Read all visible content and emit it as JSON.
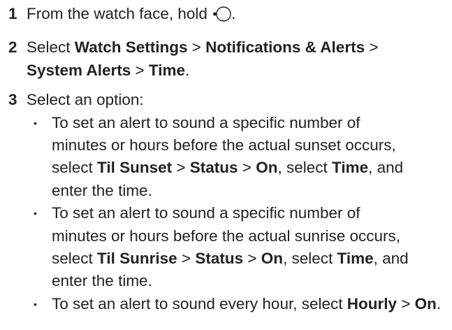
{
  "steps": [
    {
      "number": "1",
      "before_icon": "From the watch face, hold ",
      "icon": "watch-button-icon",
      "after_icon": "."
    },
    {
      "number": "2",
      "select": "Select ",
      "m1": "Watch Settings",
      "sep": " > ",
      "m2": "Notifications & Alerts",
      "m3": "System Alerts",
      "m4": "Time",
      "end": "."
    },
    {
      "number": "3",
      "text": "Select an option:"
    }
  ],
  "bullets": [
    {
      "t1": "To set an alert to sound a specific number of minutes or hours before the actual sunset occurs, select ",
      "b1": "Til Sunset",
      "sep": " > ",
      "b2": "Status",
      "b3": "On",
      "t2": ", select ",
      "b4": "Time",
      "t3": ", and enter the time."
    },
    {
      "t1": "To set an alert to sound a specific number of minutes or hours before the actual sunrise occurs, select ",
      "b1": "Til Sunrise",
      "sep": " > ",
      "b2": "Status",
      "b3": "On",
      "t2": ", select ",
      "b4": "Time",
      "t3": ", and enter the time."
    },
    {
      "t1": "To set an alert to sound every hour, select ",
      "b1": "Hourly",
      "sep": " > ",
      "b2": "On",
      "end": "."
    }
  ]
}
